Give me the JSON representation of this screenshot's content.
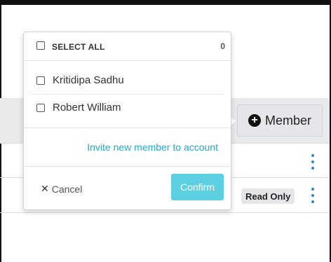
{
  "toolbar": {
    "member_button_label": "Member"
  },
  "rows": [
    {
      "badge": ""
    },
    {
      "badge": "Read Only"
    }
  ],
  "popover": {
    "select_all_label": "SELECT ALL",
    "selected_count": "0",
    "members": [
      {
        "name": "Kritidipa Sadhu"
      },
      {
        "name": "Robert William"
      }
    ],
    "invite_link": "Invite new member to account",
    "cancel_label": "Cancel",
    "confirm_label": "Confirm"
  },
  "colors": {
    "accent": "#5ccfe0",
    "link": "#29a8c8",
    "kebab": "#1a8fd1"
  }
}
